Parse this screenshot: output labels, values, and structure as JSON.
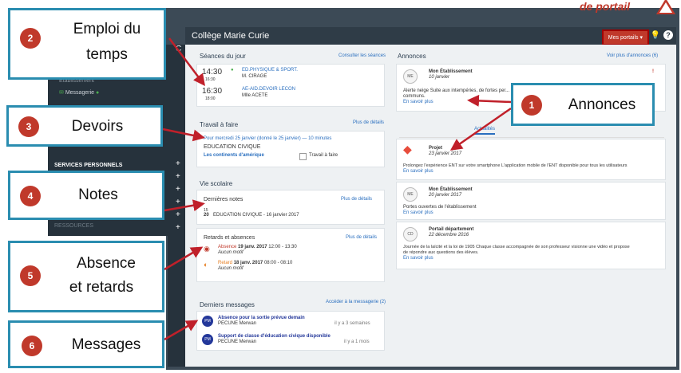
{
  "header": {
    "top_note": "de portail",
    "app_title": "Collège Marie Curie",
    "portals_label": "Mes portails",
    "help_label": "?"
  },
  "sidebar": {
    "items": [
      {
        "label": "Etablissement"
      },
      {
        "label": "Messagerie"
      }
    ],
    "section_personal": "SERVICES PERSONNELS",
    "section_other": "RESSOURCES"
  },
  "seances": {
    "title": "Séances du jour",
    "link": "Consulter les séances",
    "rows": [
      {
        "start": "14:30",
        "end": "16:30",
        "subject": "ED.PHYSIQUE & SPORT.",
        "teacher": "M. CIRAGE"
      },
      {
        "start": "16:30",
        "end": "18:00",
        "subject": "AE-AID.DEVOIR LECON",
        "teacher": "Mlle ACETE"
      }
    ]
  },
  "travail": {
    "title": "Travail à faire",
    "link": "Plus de détails",
    "line1": "Pour mercredi 25 janvier (donné le 25 janvier) — 10 minutes",
    "subject": "EDUCATION CIVIQUE",
    "topic": "Les continents d'amérique",
    "todo_label": "Travail à faire"
  },
  "vie": {
    "title": "Vie scolaire",
    "notes_title": "Dernières notes",
    "notes_link": "Plus de détails",
    "grade_num": "15",
    "grade_den": "20",
    "grade_text": "EDUCATION CIVIQUE - 16 janvier 2017",
    "ret_title": "Retards et absences",
    "ret_link": "Plus de détails",
    "absence_kind": "Absence",
    "absence_date": "19 janv. 2017",
    "absence_time": "12:00 - 13:30",
    "absence_motif": "Aucun motif",
    "retard_kind": "Retard",
    "retard_date": "18 janv. 2017",
    "retard_time": "08:00 - 08:10",
    "retard_motif": "Aucun motif"
  },
  "messages": {
    "title": "Derniers messages",
    "link": "Accéder à la messagerie (2)",
    "items": [
      {
        "avatar": "PM",
        "subject": "Absence pour la sortie prévue demain",
        "author": "PECUNE Merwan",
        "age": "il y a 3 semaines"
      },
      {
        "avatar": "PM",
        "subject": "Support de classe d'éducation civique disponible",
        "author": "PECUNE Merwan",
        "age": "il y a 1 mois"
      }
    ]
  },
  "annonces": {
    "title": "Annonces",
    "link": "Voir plus d'annonces (6)",
    "first": {
      "logo": "ME",
      "source": "Mon Établissement",
      "date": "10 janvier",
      "text": "Alerte neige Suite aux intempéries, de fortes per...",
      "more_line": "communs.",
      "more": "En savoir plus"
    },
    "tab_active": "Actualités",
    "news": [
      {
        "logo": "◆",
        "source": "Projet",
        "date": "23 janvier 2017",
        "text": "Prolongez l'expérience ENT sur votre smartphone L'application mobile de l'ENT disponible pour tous les utilisateurs",
        "more": "En savoir plus"
      },
      {
        "logo": "ME",
        "source": "Mon Établissement",
        "date": "20 janvier 2017",
        "text": "Portes ouvertes de l'établissement",
        "more": "En savoir plus"
      },
      {
        "logo": "CD",
        "source": "Portail département",
        "date": "22 décembre 2016",
        "text": "Journée de la laïcité et la loi de 1905 Chaque classe accompagnée de son professeur visionne une vidéo et propose",
        "text2": "de répondre aux questions des élèves.",
        "more": "En savoir plus"
      }
    ]
  },
  "callouts": [
    {
      "num": "1",
      "label": "Annonces"
    },
    {
      "num": "2",
      "label1": "Emploi du",
      "label2": "temps"
    },
    {
      "num": "3",
      "label": "Devoirs"
    },
    {
      "num": "4",
      "label": "Notes"
    },
    {
      "num": "5",
      "label1": "Absence",
      "label2": "et retards"
    },
    {
      "num": "6",
      "label": "Messages"
    }
  ],
  "colors": {
    "accent": "#2a6fbf",
    "callout_border": "#2a8db0",
    "badge": "#c0392b",
    "sidebar": "#26323c"
  }
}
